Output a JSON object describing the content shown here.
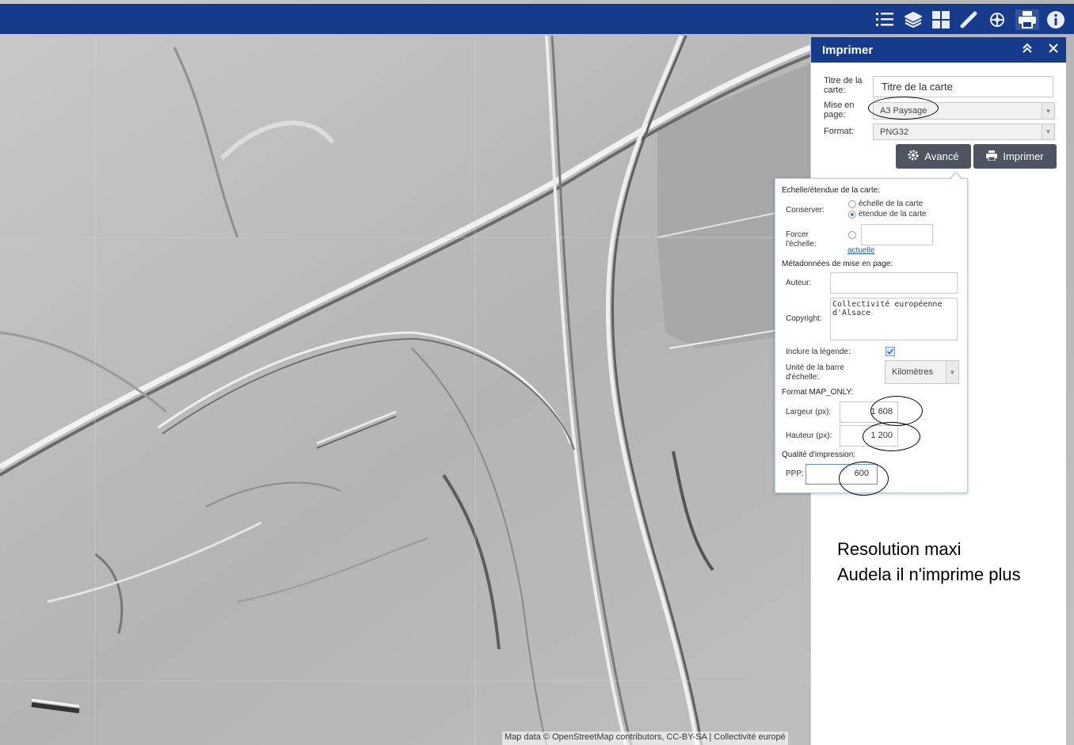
{
  "toolbar": {
    "icons": [
      "legend-list-icon",
      "layers-icon",
      "basemap-grid-icon",
      "measure-ruler-icon",
      "draw-icon",
      "print-icon",
      "info-icon"
    ],
    "active": "print-icon",
    "bg": "#163b8c"
  },
  "panel": {
    "title": "Imprimer",
    "collapse_icon": "double-chevron-up-icon",
    "close_icon": "close-icon",
    "fields": {
      "title_label": "Titre de la carte:",
      "title_value": "Titre de la carte",
      "layout_label": "Mise en page:",
      "layout_value": "A3 Paysage",
      "format_label": "Format:",
      "format_value": "PNG32"
    },
    "buttons": {
      "advanced": "Avancé",
      "print": "Imprimer"
    }
  },
  "advanced": {
    "scale_header": "Echelle/étendue de la carte:",
    "keep_label": "Conserver:",
    "keep_options": [
      "échelle de la carte",
      "étendue de la carte"
    ],
    "keep_selected": "étendue de la carte",
    "force_label": "Forcer l'échelle:",
    "force_link": "actuelle",
    "meta_header": "Métadonnées de mise en page:",
    "author_label": "Auteur:",
    "author_value": "",
    "copyright_label": "Copyright:",
    "copyright_value": "Collectivité européenne d'Alsace",
    "legend_label": "Inclure la légende:",
    "legend_checked": true,
    "scalebar_label": "Unité de la barre d'échelle:",
    "scalebar_value": "Kilomètres",
    "maponly_header": "Format MAP_ONLY:",
    "width_label": "Largeur (px):",
    "width_value": "1 608",
    "height_label": "Hauteur (px):",
    "height_value": "1 200",
    "quality_header": "Qualité d'impression:",
    "dpi_label": "PPP:",
    "dpi_value": "600"
  },
  "annotation": {
    "line1": "Resolution maxi",
    "line2": "Audela il n'imprime plus"
  },
  "attribution": "Map data © OpenStreetMap contributors, CC-BY-SA | Collectivité europé"
}
